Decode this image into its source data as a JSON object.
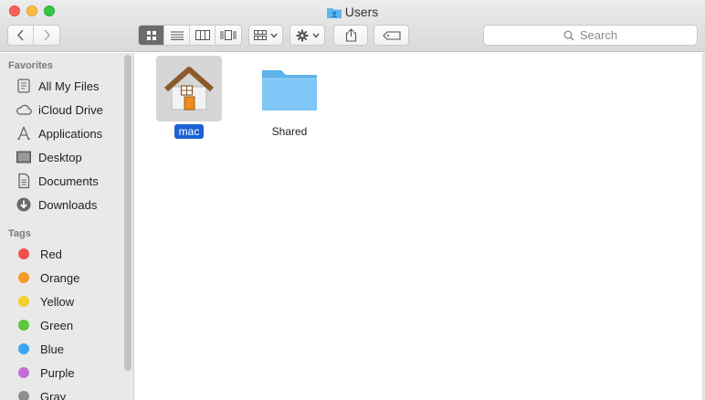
{
  "window": {
    "title": "Users"
  },
  "toolbar": {
    "search_placeholder": "Search"
  },
  "sidebar": {
    "favorites_title": "Favorites",
    "favorites": [
      {
        "label": "All My Files",
        "icon": "all-files-icon"
      },
      {
        "label": "iCloud Drive",
        "icon": "cloud-icon"
      },
      {
        "label": "Applications",
        "icon": "applications-icon"
      },
      {
        "label": "Desktop",
        "icon": "desktop-icon"
      },
      {
        "label": "Documents",
        "icon": "documents-icon"
      },
      {
        "label": "Downloads",
        "icon": "downloads-icon"
      }
    ],
    "tags_title": "Tags",
    "tags": [
      {
        "label": "Red",
        "color": "#f0504a"
      },
      {
        "label": "Orange",
        "color": "#f59a2b"
      },
      {
        "label": "Yellow",
        "color": "#f5cd2d"
      },
      {
        "label": "Green",
        "color": "#5cc63e"
      },
      {
        "label": "Blue",
        "color": "#3aa8f0"
      },
      {
        "label": "Purple",
        "color": "#c46fd6"
      },
      {
        "label": "Gray",
        "color": "#8e8e8e"
      }
    ]
  },
  "files": [
    {
      "name": "mac",
      "type": "home-folder",
      "selected": true
    },
    {
      "name": "Shared",
      "type": "folder",
      "selected": false
    }
  ]
}
